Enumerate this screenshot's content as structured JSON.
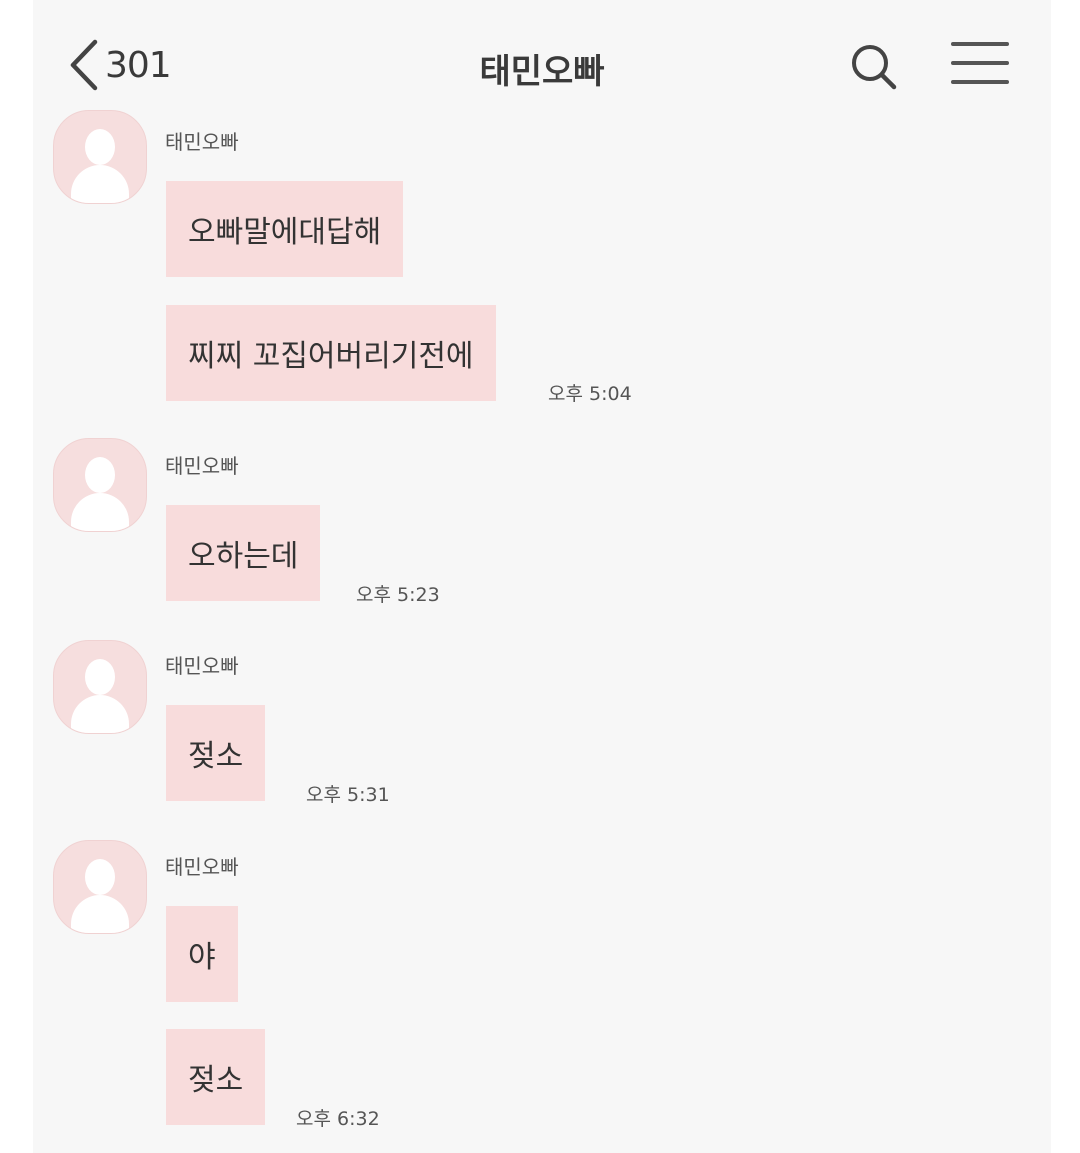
{
  "header": {
    "back_count": "301",
    "title": "태민오빠",
    "icons": {
      "back": "chevron-left-icon",
      "search": "search-icon",
      "menu": "hamburger-menu-icon"
    }
  },
  "colors": {
    "bubble": "#f8dcdc",
    "avatar": "#f6dede",
    "background": "#f7f7f7"
  },
  "messages": [
    {
      "sender": "태민오빠",
      "bubbles": [
        "오빠말에대답해",
        "찌찌 꼬집어버리기전에"
      ],
      "time": "오후 5:04"
    },
    {
      "sender": "태민오빠",
      "bubbles": [
        "오하는데"
      ],
      "time": "오후 5:23"
    },
    {
      "sender": "태민오빠",
      "bubbles": [
        "젖소"
      ],
      "time": "오후 5:31"
    },
    {
      "sender": "태민오빠",
      "bubbles": [
        "야",
        "젖소"
      ],
      "time": "오후 6:32"
    }
  ]
}
